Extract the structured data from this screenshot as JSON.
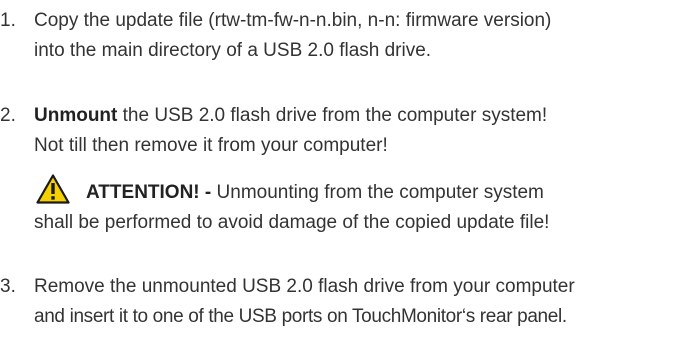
{
  "steps": [
    {
      "number": "1.",
      "lines": [
        "Copy the update file (rtw-tm-fw-n-n.bin, n-n: firmware version)",
        "into the main directory of a USB 2.0 flash drive."
      ]
    },
    {
      "number": "2.",
      "bold_word": "Unmount",
      "line1_rest": " the USB 2.0 flash drive from the computer system!",
      "line2": "Not till then remove it from your computer!"
    },
    {
      "number": "3.",
      "lines": [
        "Remove the unmounted USB 2.0 flash drive from your computer",
        "and insert it to one of the USB ports on TouchMonitor‘s rear panel."
      ]
    }
  ],
  "warning": {
    "icon": "warning-triangle-icon",
    "icon_fill": "#f5d000",
    "label": "ATTENTION! -",
    "line1_rest": " Unmounting from the computer system",
    "line2": "shall be performed to avoid damage of the copied update file!"
  }
}
